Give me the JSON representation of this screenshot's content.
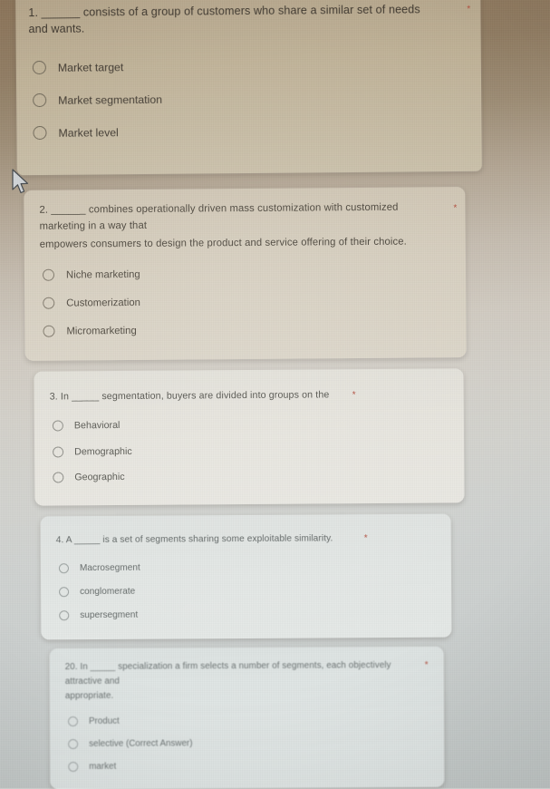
{
  "form": {
    "required_marker": "*",
    "accent_required_color": "#b04a3a"
  },
  "cursor": {
    "icon": "arrow-cursor-icon"
  },
  "questions": [
    {
      "number": "1.",
      "lines": [
        "1. ______ consists of a group of customers who share a similar set of needs",
        "and wants."
      ],
      "text_line1": "1. ______ consists of a group of customers who share a similar set of needs",
      "text_line2": "and wants.",
      "required": "*",
      "options": [
        {
          "label": "Market target"
        },
        {
          "label": "Market segmentation"
        },
        {
          "label": "Market level"
        }
      ]
    },
    {
      "number": "2.",
      "text_line1": "2. ______ combines operationally driven mass customization with customized",
      "text_line2": "marketing in a way that",
      "text_line3": "empowers consumers to design the product and service offering of their choice.",
      "required": "*",
      "options": [
        {
          "label": "Niche marketing"
        },
        {
          "label": "Customerization"
        },
        {
          "label": "Micromarketing"
        }
      ]
    },
    {
      "number": "3.",
      "text_line1": "3. In _____ segmentation, buyers are divided into groups on the",
      "required": "*",
      "options": [
        {
          "label": "Behavioral"
        },
        {
          "label": "Demographic"
        },
        {
          "label": "Geographic"
        }
      ]
    },
    {
      "number": "4.",
      "text_line1": "4. A _____ is a set of segments sharing some exploitable similarity.",
      "required": "*",
      "options": [
        {
          "label": "Macrosegment"
        },
        {
          "label": "conglomerate"
        },
        {
          "label": "supersegment"
        }
      ]
    },
    {
      "number": "20.",
      "text_line1": "20. In _____ specialization a firm selects a number of segments, each objectively",
      "text_line2": "attractive and",
      "text_line3": "appropriate.",
      "required": "*",
      "options": [
        {
          "label": "Product"
        },
        {
          "label": "selective (Correct Answer)"
        },
        {
          "label": "market"
        }
      ]
    }
  ]
}
